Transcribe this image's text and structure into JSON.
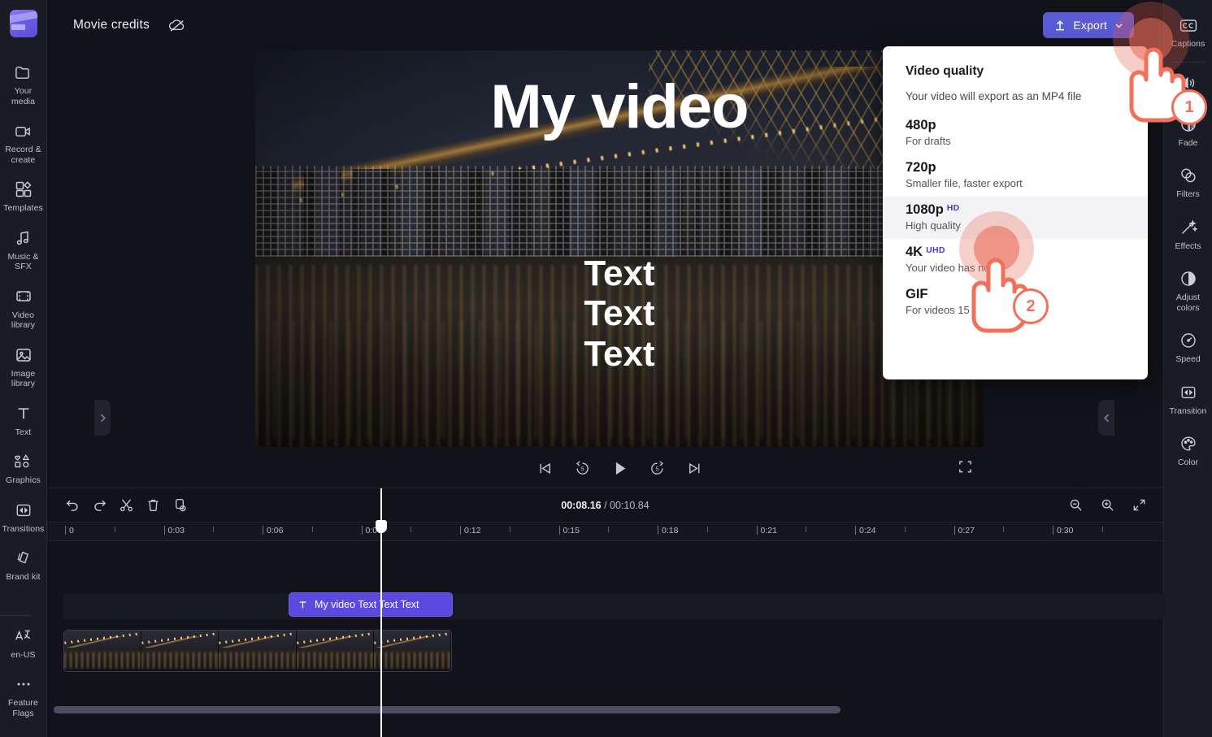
{
  "app": {
    "project_title": "Movie credits",
    "logo_name": "clipchamp-logo"
  },
  "topbar": {
    "export_label": "Export",
    "cloud_icon": "cloud-off-icon",
    "chevron_icon": "chevron-down-icon",
    "upload_icon": "upload-arrow-icon"
  },
  "left_sidebar": {
    "items": [
      {
        "label": "Your media",
        "icon": "folder-icon"
      },
      {
        "label": "Record & create",
        "icon": "video-camera-icon"
      },
      {
        "label": "Templates",
        "icon": "templates-grid-icon"
      },
      {
        "label": "Music & SFX",
        "icon": "music-note-icon"
      },
      {
        "label": "Video library",
        "icon": "film-strip-icon"
      },
      {
        "label": "Image library",
        "icon": "image-icon"
      },
      {
        "label": "Text",
        "icon": "text-t-icon"
      },
      {
        "label": "Graphics",
        "icon": "shapes-icon"
      },
      {
        "label": "Transitions",
        "icon": "transition-icon"
      },
      {
        "label": "Brand kit",
        "icon": "brand-kit-icon"
      }
    ],
    "bottom_items": [
      {
        "label": "en-US",
        "icon": "language-icon"
      },
      {
        "label": "Feature Flags",
        "icon": "ellipsis-icon"
      }
    ]
  },
  "right_sidebar": {
    "items": [
      {
        "label": "Captions",
        "icon": "cc-icon"
      },
      {
        "label": "",
        "icon": "volume-icon"
      },
      {
        "label": "Fade",
        "icon": "fade-icon"
      },
      {
        "label": "Filters",
        "icon": "filters-icon"
      },
      {
        "label": "Effects",
        "icon": "effects-wand-icon"
      },
      {
        "label": "Adjust colors",
        "icon": "adjust-colors-icon"
      },
      {
        "label": "Speed",
        "icon": "speedometer-icon"
      },
      {
        "label": "Transition",
        "icon": "transition-icon"
      },
      {
        "label": "Color",
        "icon": "palette-icon"
      }
    ]
  },
  "preview": {
    "overlay_title": "My video",
    "overlay_lines": "Text\nText\nText",
    "transport": {
      "skip_start": "skip-to-start-icon",
      "back5": "rewind-5-icon",
      "play": "play-icon",
      "forward5": "forward-5-icon",
      "skip_end": "skip-to-end-icon",
      "fullscreen": "fullscreen-icon"
    },
    "help_label": "?",
    "collapse_left_icon": "chevron-right-icon",
    "collapse_right_icon": "chevron-left-icon",
    "collapse_down_icon": "chevron-down-icon"
  },
  "timeline": {
    "tools": [
      {
        "name": "undo-button",
        "icon": "undo-icon"
      },
      {
        "name": "redo-button",
        "icon": "redo-icon"
      },
      {
        "name": "split-button",
        "icon": "scissors-icon"
      },
      {
        "name": "delete-button",
        "icon": "trash-icon"
      },
      {
        "name": "duplicate-button",
        "icon": "duplicate-icon"
      }
    ],
    "current_time": "00:08.16",
    "time_separator": " / ",
    "total_time": "00:10.84",
    "zoom_out_icon": "zoom-out-icon",
    "zoom_in_icon": "zoom-in-icon",
    "fit_icon": "fit-to-screen-icon",
    "ruler_labels": [
      "0",
      "0:03",
      "0:06",
      "0:09",
      "0:12",
      "0:15",
      "0:18",
      "0:21",
      "0:24",
      "0:27",
      "0:30"
    ],
    "text_clip_label": "My video Text Text Text",
    "text_clip_icon": "text-t-icon"
  },
  "export_menu": {
    "title": "Video quality",
    "subtitle": "Your video will export as an MP4 file",
    "options": [
      {
        "label": "480p",
        "badge": "",
        "desc": "For drafts",
        "selected": false
      },
      {
        "label": "720p",
        "badge": "",
        "desc": "Smaller file, faster export",
        "selected": false
      },
      {
        "label": "1080p",
        "badge": "HD",
        "desc": "High quality",
        "selected": true
      },
      {
        "label": "4K",
        "badge": "UHD",
        "desc": "Your video has no 4",
        "selected": false
      },
      {
        "label": "GIF",
        "badge": "",
        "desc": "For videos 15 seconds or less",
        "selected": false
      }
    ]
  },
  "callouts": [
    {
      "number": "1",
      "target": "export-button"
    },
    {
      "number": "2",
      "target": "export-option-1080p"
    }
  ],
  "colors": {
    "accent_purple": "#5b5bd6",
    "clip_purple": "#5b4ae0",
    "callout_coral": "#f2705a",
    "badge_blue": "#4b36d8",
    "panel_dark": "#1b1b26",
    "canvas_dark": "#12121a"
  }
}
